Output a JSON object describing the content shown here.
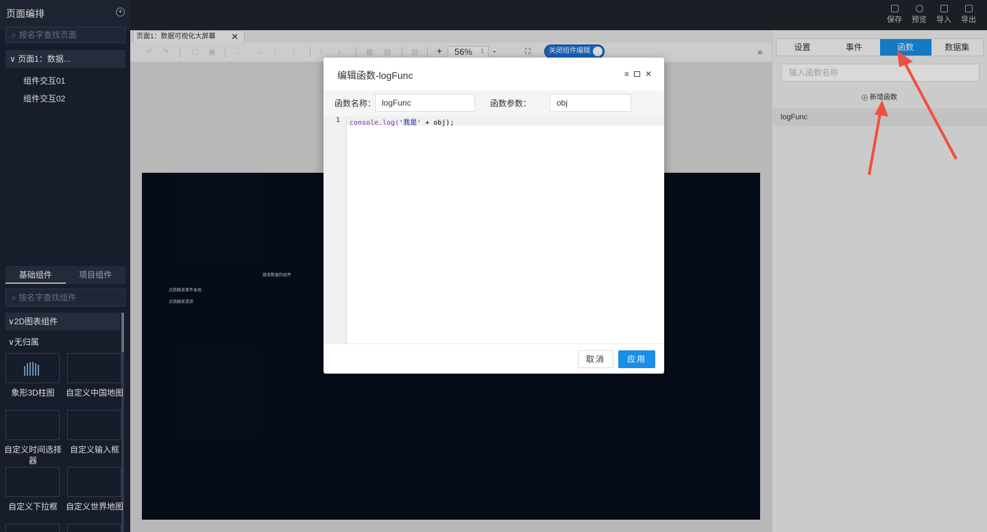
{
  "left_panel": {
    "title": "页面编排",
    "page_search_placeholder": "按名字查找页面",
    "page_item": "页面1：数据...",
    "components": [
      "组件交互01",
      "组件交互02"
    ],
    "library_tabs": [
      "基础组件",
      "项目组件"
    ],
    "component_search_placeholder": "按名字查找组件",
    "group_2d": "2D图表组件",
    "group_none": "无归属",
    "tiles": [
      "象形3D柱图",
      "自定义中国地图",
      "自定义时间选择器",
      "自定义输入框",
      "自定义下拉框",
      "自定义世界地图"
    ]
  },
  "top_actions": [
    "保存",
    "预览",
    "导入",
    "导出"
  ],
  "doc_tab": {
    "label": "页面1：数据可视化大屏幕",
    "close": "✕"
  },
  "toolbar": {
    "zoom": "56%",
    "plus": "+",
    "minus": "-",
    "toggle_label": "关闭组件编辑",
    "more": "»"
  },
  "canvas": {
    "texts": [
      "接收数据的组件",
      "点我触发事件本地",
      "点我触发请求"
    ]
  },
  "right_panel": {
    "tabs": [
      "设置",
      "事件",
      "函数",
      "数据集"
    ],
    "active_tab": "函数",
    "search_placeholder": "输入函数名称",
    "add_label": "新增函数",
    "functions": [
      "logFunc"
    ]
  },
  "modal": {
    "title": "编辑函数-logFunc",
    "name_label": "函数名称：",
    "name_value": "logFunc",
    "param_label": "函数参数：",
    "param_value": "obj",
    "line_number": "1",
    "code_fn": "console.log(",
    "code_str": "'我是'",
    "code_rest": " + obj);",
    "cancel_label": "取消",
    "apply_label": "应用"
  },
  "colors": {
    "accent": "#1a8fe8",
    "dark_bg": "#1c2333",
    "canvas_bg": "#090f1e"
  }
}
